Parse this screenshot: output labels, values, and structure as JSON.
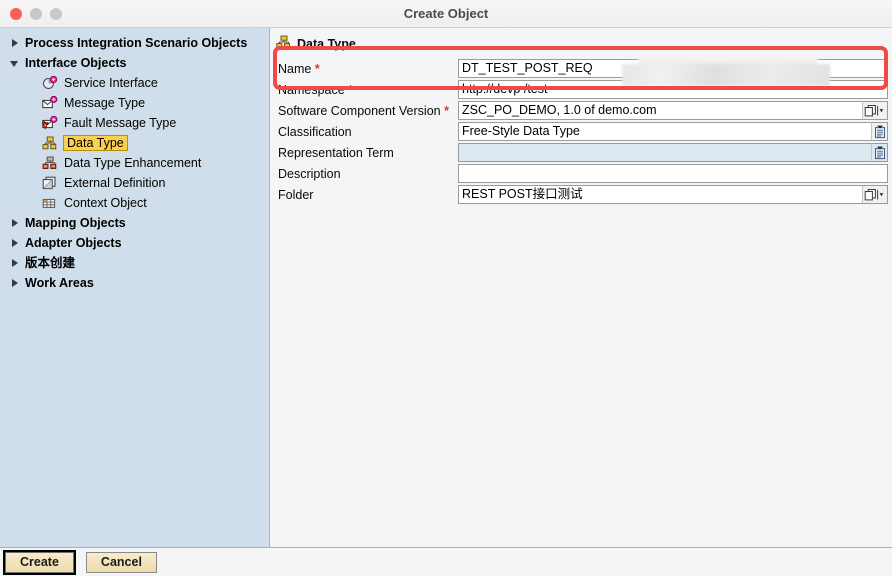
{
  "window": {
    "title": "Create Object",
    "controls": [
      "close",
      "minimize",
      "maximize"
    ]
  },
  "sidebar": {
    "items": [
      {
        "label": "Process Integration Scenario Objects",
        "level": 0,
        "arrow": "collapsed",
        "icon": "none",
        "selected": false
      },
      {
        "label": "Interface Objects",
        "level": 0,
        "arrow": "expanded",
        "icon": "none",
        "selected": false
      },
      {
        "label": "Service Interface",
        "level": 1,
        "arrow": "none",
        "icon": "service-interface-icon",
        "selected": false
      },
      {
        "label": "Message Type",
        "level": 1,
        "arrow": "none",
        "icon": "message-type-icon",
        "selected": false
      },
      {
        "label": "Fault Message Type",
        "level": 1,
        "arrow": "none",
        "icon": "fault-message-type-icon",
        "selected": false
      },
      {
        "label": "Data Type",
        "level": 1,
        "arrow": "none",
        "icon": "data-type-icon",
        "selected": true
      },
      {
        "label": "Data Type Enhancement",
        "level": 1,
        "arrow": "none",
        "icon": "data-type-enhancement-icon",
        "selected": false
      },
      {
        "label": "External Definition",
        "level": 1,
        "arrow": "none",
        "icon": "external-definition-icon",
        "selected": false
      },
      {
        "label": "Context Object",
        "level": 1,
        "arrow": "none",
        "icon": "context-object-icon",
        "selected": false
      },
      {
        "label": "Mapping Objects",
        "level": 0,
        "arrow": "collapsed",
        "icon": "none",
        "selected": false
      },
      {
        "label": "Adapter Objects",
        "level": 0,
        "arrow": "collapsed",
        "icon": "none",
        "selected": false
      },
      {
        "label": "版本创建",
        "level": 0,
        "arrow": "collapsed",
        "icon": "none",
        "selected": false
      },
      {
        "label": "Work Areas",
        "level": 0,
        "arrow": "collapsed",
        "icon": "none",
        "selected": false
      }
    ]
  },
  "main": {
    "section_title": "Data Type",
    "section_icon": "data-type-icon",
    "fields": [
      {
        "label": "Name",
        "required": true,
        "value": "DT_TEST_POST_REQ",
        "placeholder": "",
        "control": "text",
        "readonly": false
      },
      {
        "label": "Namespace",
        "required": true,
        "value": "http://devp                       /test",
        "value_visible_prefix": "http://devp",
        "value_visible_suffix": "/test",
        "placeholder": "",
        "control": "text",
        "readonly": false,
        "redacted": true
      },
      {
        "label": "Software Component Version",
        "required": true,
        "value": "ZSC_PO_DEMO, 1.0 of demo.com",
        "placeholder": "",
        "control": "browse",
        "readonly": false
      },
      {
        "label": "Classification",
        "required": false,
        "value": "Free-Style Data Type",
        "placeholder": "",
        "control": "list",
        "readonly": false
      },
      {
        "label": "Representation Term",
        "required": false,
        "value": "",
        "placeholder": "",
        "control": "list",
        "readonly": true
      },
      {
        "label": "Description",
        "required": false,
        "value": "",
        "placeholder": "",
        "control": "text",
        "readonly": false
      },
      {
        "label": "Folder",
        "required": false,
        "value": "REST POST接口测试",
        "placeholder": "",
        "control": "browse",
        "readonly": false
      }
    ],
    "annotation": {
      "type": "red-highlight-rectangle",
      "covers": [
        "Name",
        "Namespace"
      ],
      "color": "#ef4b44"
    }
  },
  "footer": {
    "create_label": "Create",
    "cancel_label": "Cancel",
    "focused_button": "Create"
  },
  "colors": {
    "sidebar_bg": "#cfdeea",
    "content_bg": "#f4f5f6",
    "selection": "#fbcf4d",
    "annotation_red": "#ef4b44",
    "button_face": "#ecdcae",
    "readonly_field": "#dde7f0"
  }
}
